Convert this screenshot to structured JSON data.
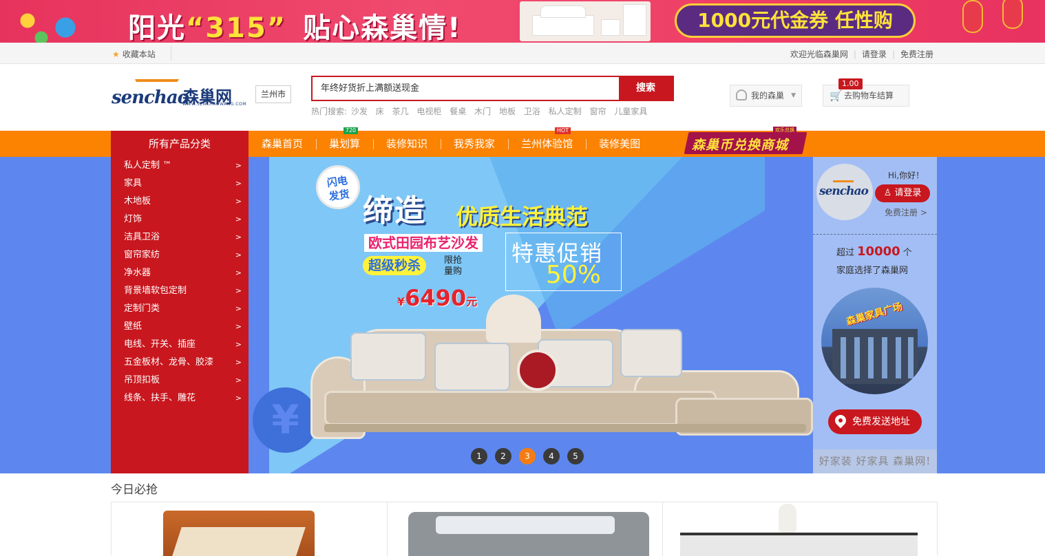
{
  "promo_banner": {
    "headline_part1": "阳光",
    "headline_quote": "“315”",
    "headline_part2": "贴心森巢情!",
    "coupon": "1000元代金券 任性购"
  },
  "util_bar": {
    "favorite": "收藏本站",
    "welcome": "欢迎光临森巢网",
    "login": "请登录",
    "register": "免费注册"
  },
  "header": {
    "logo_en": "senchao",
    "logo_cn": "森巢网",
    "logo_url": "WWW.SENCHAOWANG.COM",
    "city": "兰州市",
    "search_placeholder": "年终好货折上满额送现金",
    "search_button": "搜索",
    "hot_label": "热门搜索:",
    "hot_terms": [
      "沙发",
      "床",
      "茶几",
      "电视柜",
      "餐桌",
      "木门",
      "地板",
      "卫浴",
      "私人定制",
      "窗帘",
      "儿童家具"
    ],
    "my_account": "我的森巢",
    "cart_label": "去购物车结算",
    "cart_count": "1.00"
  },
  "nav": {
    "all_categories": "所有产品分类",
    "items": [
      {
        "label": "森巢首页",
        "tag": ""
      },
      {
        "label": "巢划算",
        "tag": "720"
      },
      {
        "label": "装修知识",
        "tag": ""
      },
      {
        "label": "我秀我家",
        "tag": ""
      },
      {
        "label": "兰州体验馆",
        "tag": "HOT"
      },
      {
        "label": "装修美图",
        "tag": ""
      }
    ],
    "coin_mall": "森巢币兑换商城",
    "coin_mall_sub": "欢乐兑换"
  },
  "categories": [
    "私人定制 ™",
    "家具",
    "木地板",
    "灯饰",
    "洁具卫浴",
    "窗帘家纺",
    "净水器",
    "背景墙软包定制",
    "定制门类",
    "壁纸",
    "电线、开关、插座",
    "五金板材、龙骨、胶漆",
    "吊顶扣板",
    "线条、扶手、雕花"
  ],
  "slide": {
    "badge": "闪电发货",
    "title_big": "缔造",
    "title_rest": "优质生活典范",
    "subtitle": "欧式田园布艺沙发",
    "flash": "超级秒杀",
    "limited": "限抢\n量购",
    "price_symbol": "¥",
    "price": "6490",
    "price_unit": "元",
    "promo": "特惠促销",
    "discount": "50%",
    "coin_symbol": "¥",
    "pages": [
      "1",
      "2",
      "3",
      "4",
      "5"
    ],
    "active_page": "3"
  },
  "right_panel": {
    "logo": "senchao",
    "greeting": "Hi,你好！",
    "login_button": "请登录",
    "register_link": "免费注册 >",
    "stat_prefix": "超过",
    "stat_number": "10000",
    "stat_suffix": "个",
    "stat_line2": "家庭选择了森巢网",
    "plaza": "森巢家具广场",
    "address_button": "免费发送地址",
    "slogan": "好家装 好家具 森巢网!"
  },
  "today": {
    "title": "今日必抢"
  }
}
